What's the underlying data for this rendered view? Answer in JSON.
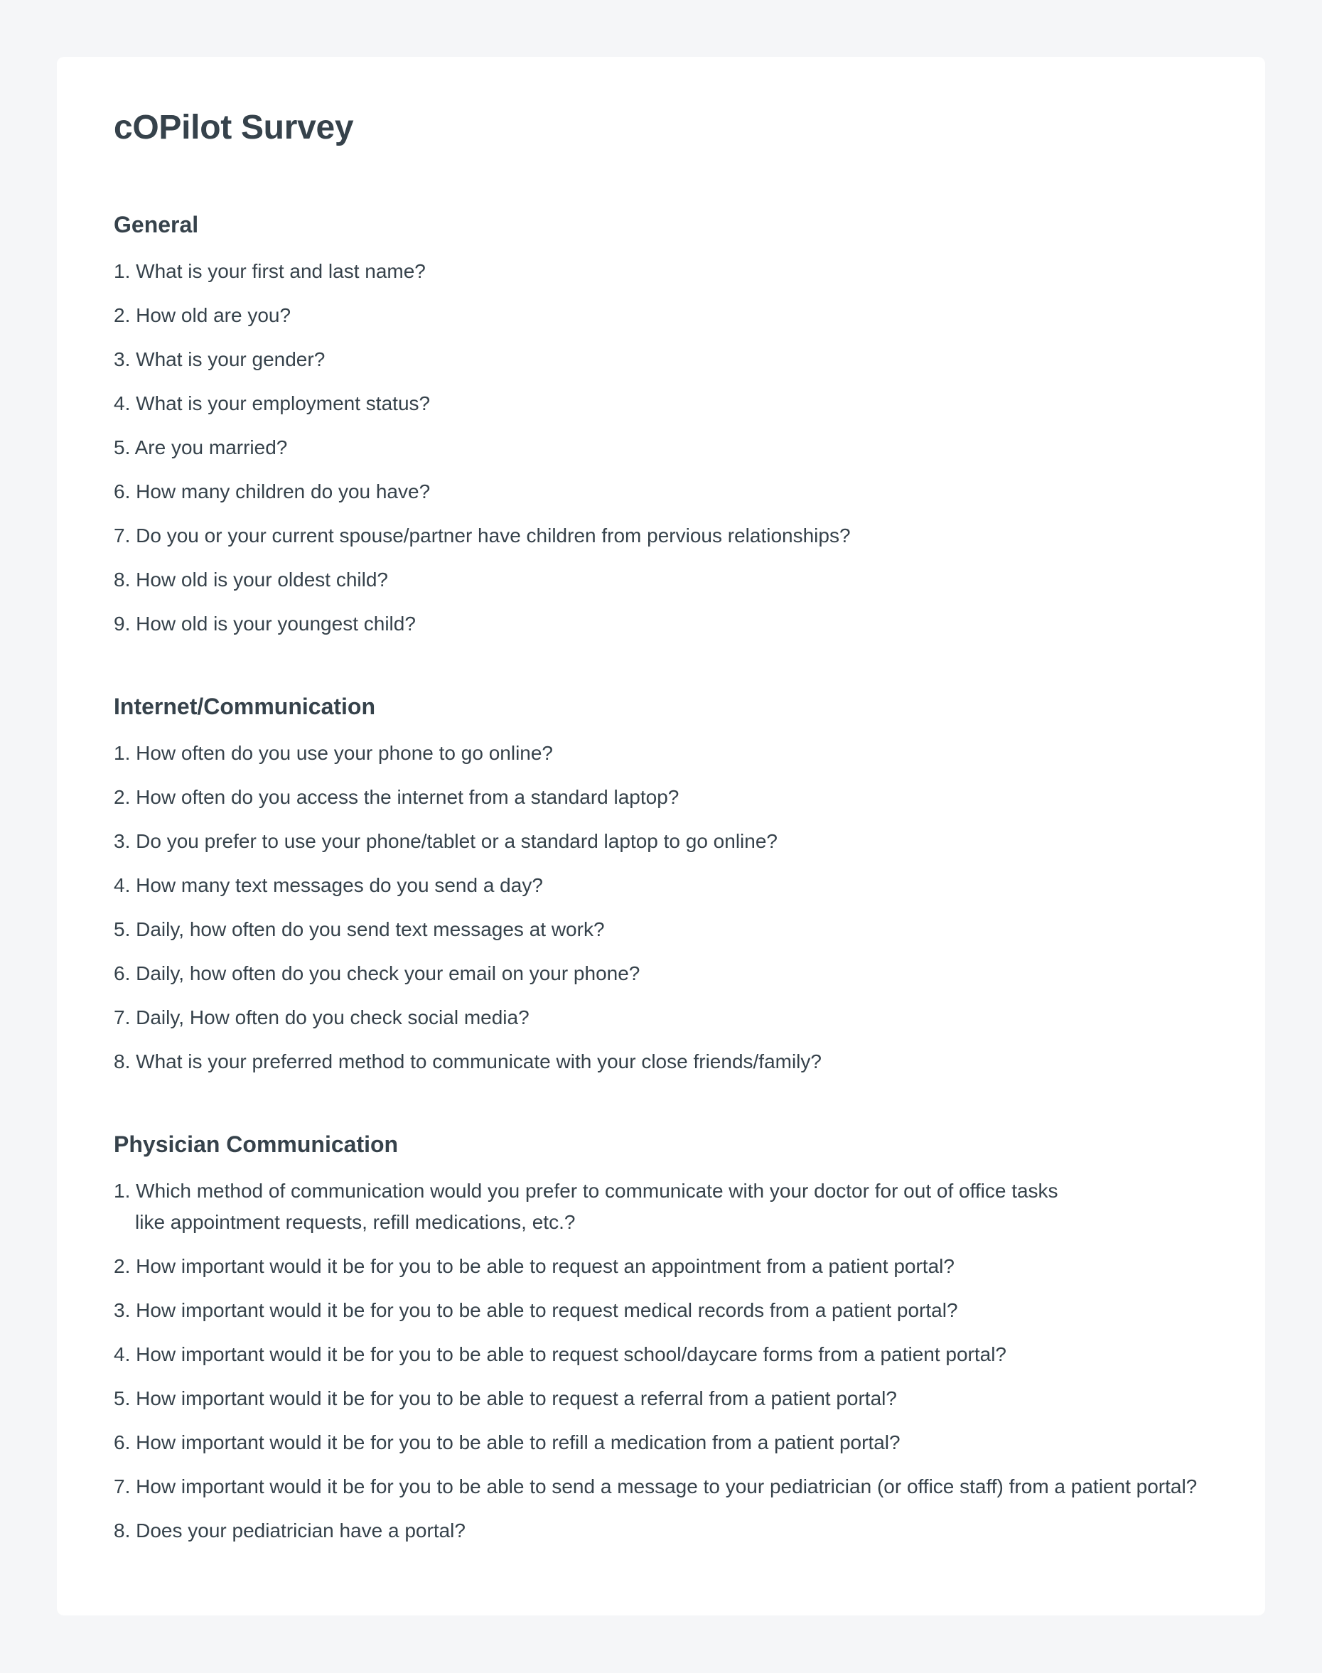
{
  "page": {
    "title": "cOPilot Survey"
  },
  "sections": [
    {
      "title": "General",
      "questions": [
        {
          "num": "1.",
          "text": "What is your first and last name?"
        },
        {
          "num": "2.",
          "text": "How old are you?"
        },
        {
          "num": "3.",
          "text": "What is your gender?"
        },
        {
          "num": "4.",
          "text": "What is your employment status?"
        },
        {
          "num": "5.",
          "text": "Are you married?"
        },
        {
          "num": "6.",
          "text": "How many children do you have?"
        },
        {
          "num": "7.",
          "text": "Do you or your current spouse/partner have children from pervious relationships?"
        },
        {
          "num": "8.",
          "text": "How old is your oldest child?"
        },
        {
          "num": "9.",
          "text": "How old is your youngest child?"
        }
      ]
    },
    {
      "title": "Internet/Communication",
      "questions": [
        {
          "num": "1.",
          "text": "How often do you use your phone to go online?"
        },
        {
          "num": "2.",
          "text": "How often do you access the internet from a standard laptop?"
        },
        {
          "num": "3.",
          "text": "Do you prefer to use your phone/tablet or a standard laptop to go online?"
        },
        {
          "num": "4.",
          "text": "How many text messages do you send a day?"
        },
        {
          "num": "5.",
          "text": "Daily, how often do you send text messages at work?"
        },
        {
          "num": "6.",
          "text": "Daily, how often do you check your email on your phone?"
        },
        {
          "num": "7.",
          "text": "Daily, How often do you check social media?"
        },
        {
          "num": "8.",
          "text": "What is your preferred method to communicate with your close friends/family?"
        }
      ]
    },
    {
      "title": "Physician Communication",
      "questions": [
        {
          "num": "1.",
          "text": "Which method of communication would you prefer to communicate with your doctor for out of office tasks like appointment requests, refill medications, etc.?"
        },
        {
          "num": "2.",
          "text": "How important would it be for you to be able to request an appointment from a patient portal?"
        },
        {
          "num": "3.",
          "text": "How important would it be for you to be able to request medical records from a patient portal?"
        },
        {
          "num": "4.",
          "text": "How important would it be for you to be able to request school/daycare forms from a patient portal?"
        },
        {
          "num": "5.",
          "text": "How important would it be for you to be able to request a referral from a patient portal?"
        },
        {
          "num": "6.",
          "text": "How important would it be for you to be able to refill a medication from a patient portal?"
        },
        {
          "num": "7.",
          "text": "How important would it be for you to be able to send a message to your pediatrician (or office staff) from a patient portal?"
        },
        {
          "num": "8.",
          "text": "Does your pediatrician have a portal?"
        }
      ]
    }
  ]
}
